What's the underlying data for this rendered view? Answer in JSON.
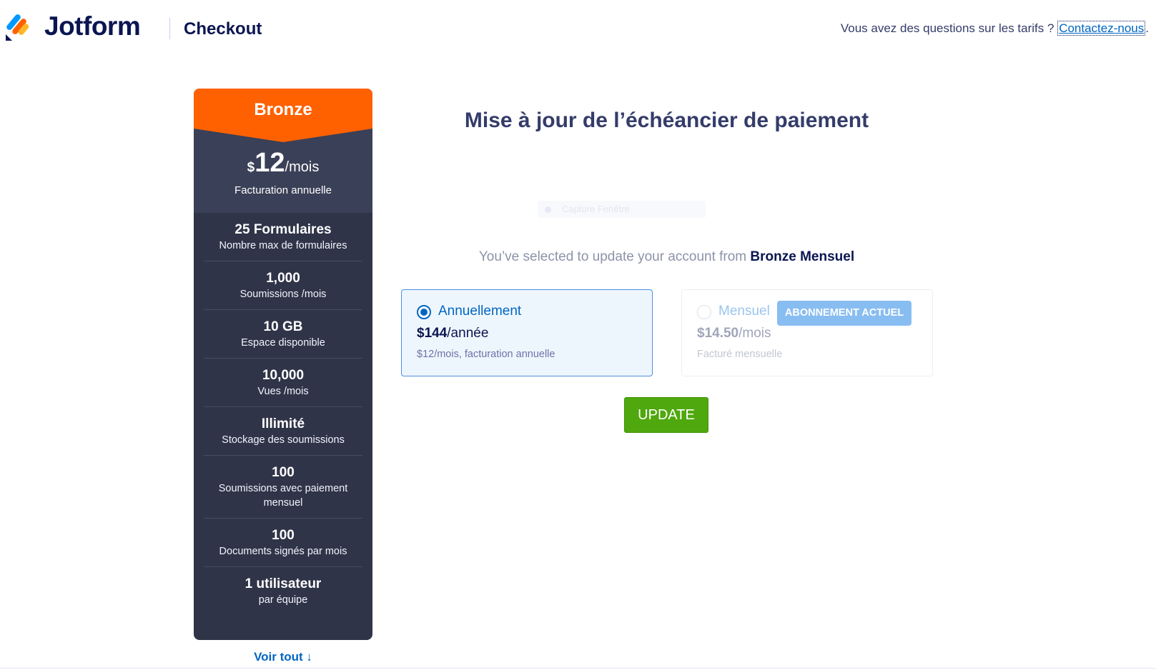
{
  "header": {
    "brand": "Jotform",
    "section": "Checkout",
    "help_text": "Vous avez des questions sur les tarifs ?",
    "help_link": "Contactez-nous",
    "help_tail": "."
  },
  "plan": {
    "name": "Bronze",
    "currency": "$",
    "price": "12",
    "period": "/mois",
    "billing": "Facturation annuelle",
    "features": [
      {
        "title": "25 Formulaires",
        "sub": "Nombre max de formulaires"
      },
      {
        "title": "1,000",
        "sub": "Soumissions /mois"
      },
      {
        "title": "10 GB",
        "sub": "Espace disponible"
      },
      {
        "title": "10,000",
        "sub": "Vues /mois"
      },
      {
        "title": "Illimité",
        "sub": "Stockage des soumissions"
      },
      {
        "title": "100",
        "sub": "Soumissions avec paiement mensuel"
      },
      {
        "title": "100",
        "sub": "Documents signés par mois"
      },
      {
        "title": "1 utilisateur",
        "sub": "par équipe"
      }
    ],
    "see_all": "Voir tout",
    "see_all_arrow": "↓"
  },
  "main": {
    "title": "Mise à jour de l’échéancier de paiement",
    "ghost_text": "Capture Fenêtre",
    "selected_prefix": "You’ve selected to update your account from",
    "selected_plan": "Bronze Mensuel",
    "options": {
      "annual": {
        "label": "Annuellement",
        "price": "$144",
        "period": "/année",
        "note": "$12/mois, facturation annuelle",
        "selected": true
      },
      "monthly": {
        "label": "Mensuel",
        "badge": "ABONNEMENT ACTUEL",
        "price": "$14.50",
        "period": "/mois",
        "note": "Facturé mensuelle",
        "selected": false
      }
    },
    "update_label": "UPDATE"
  },
  "colors": {
    "brand_orange": "#ff6100",
    "card_dark": "#2f3448",
    "link_blue": "#0066c3",
    "update_green": "#4fa80e",
    "badge_blue": "#88bdf2"
  }
}
